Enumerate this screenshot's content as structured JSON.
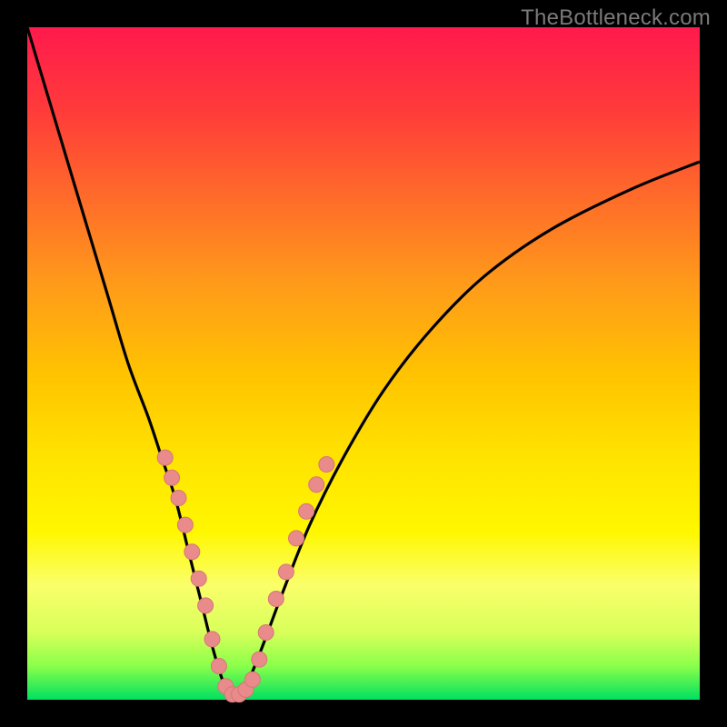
{
  "watermark": "TheBottleneck.com",
  "colors": {
    "curve": "#000000",
    "marker_fill": "#e98b8b",
    "marker_stroke": "#d77676"
  },
  "chart_data": {
    "type": "line",
    "title": "",
    "xlabel": "",
    "ylabel": "",
    "xlim": [
      0,
      100
    ],
    "ylim": [
      0,
      100
    ],
    "series": [
      {
        "name": "bottleneck-curve",
        "x": [
          0,
          3,
          6,
          9,
          12,
          15,
          18,
          20,
          22,
          24,
          26,
          27.5,
          29,
          30,
          31,
          32,
          33,
          35,
          38,
          42,
          47,
          53,
          60,
          68,
          78,
          90,
          100
        ],
        "y": [
          100,
          90,
          80,
          70,
          60,
          50,
          42,
          36,
          30,
          22,
          14,
          8,
          3,
          1,
          0.5,
          1,
          3,
          8,
          16,
          26,
          36,
          46,
          55,
          63,
          70,
          76,
          80
        ]
      }
    ],
    "markers": {
      "name": "highlight-points",
      "points": [
        {
          "x": 20.5,
          "y": 36
        },
        {
          "x": 21.5,
          "y": 33
        },
        {
          "x": 22.5,
          "y": 30
        },
        {
          "x": 23.5,
          "y": 26
        },
        {
          "x": 24.5,
          "y": 22
        },
        {
          "x": 25.5,
          "y": 18
        },
        {
          "x": 26.5,
          "y": 14
        },
        {
          "x": 27.5,
          "y": 9
        },
        {
          "x": 28.5,
          "y": 5
        },
        {
          "x": 29.5,
          "y": 2
        },
        {
          "x": 30.5,
          "y": 0.8
        },
        {
          "x": 31.5,
          "y": 0.8
        },
        {
          "x": 32.5,
          "y": 1.5
        },
        {
          "x": 33.5,
          "y": 3
        },
        {
          "x": 34.5,
          "y": 6
        },
        {
          "x": 35.5,
          "y": 10
        },
        {
          "x": 37,
          "y": 15
        },
        {
          "x": 38.5,
          "y": 19
        },
        {
          "x": 40,
          "y": 24
        },
        {
          "x": 41.5,
          "y": 28
        },
        {
          "x": 43,
          "y": 32
        },
        {
          "x": 44.5,
          "y": 35
        }
      ]
    }
  }
}
